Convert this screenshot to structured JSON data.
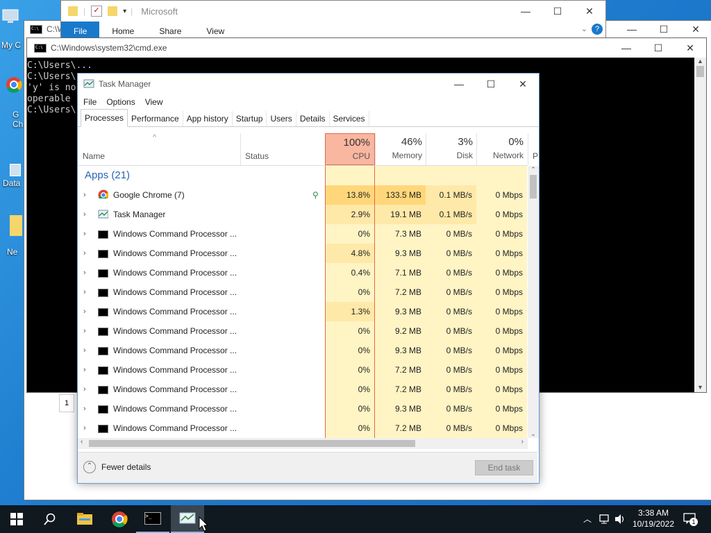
{
  "desktop": {
    "icons": [
      {
        "label": "My C"
      },
      {
        "label": "G\nCh"
      },
      {
        "label": "Data"
      },
      {
        "label": "Ne"
      }
    ]
  },
  "explorer": {
    "title": "Microsoft",
    "ribbon_tabs": [
      "File",
      "Home",
      "Share",
      "View"
    ]
  },
  "cmd_back": {
    "title": "C:\\W"
  },
  "cmd_main": {
    "title": "C:\\Windows\\system32\\cmd.exe",
    "lines": [
      "",
      "C:\\Users\\...",
      "",
      "C:\\Users\\",
      "'y' is no",
      "operable",
      "",
      "C:\\Users\\"
    ]
  },
  "task_manager": {
    "title": "Task Manager",
    "menu": [
      "File",
      "Options",
      "View"
    ],
    "tabs": [
      "Processes",
      "Performance",
      "App history",
      "Startup",
      "Users",
      "Details",
      "Services"
    ],
    "columns": {
      "name": "Name",
      "status": "Status",
      "cpu": {
        "pct": "100%",
        "label": "CPU"
      },
      "memory": {
        "pct": "46%",
        "label": "Memory"
      },
      "disk": {
        "pct": "3%",
        "label": "Disk"
      },
      "network": {
        "pct": "0%",
        "label": "Network"
      },
      "power": "P"
    },
    "group_label": "Apps (21)",
    "processes": [
      {
        "name": "Google Chrome (7)",
        "icon": "chrome-icon",
        "cpu": "13.8%",
        "memory": "133.5 MB",
        "disk": "0.1 MB/s",
        "network": "0 Mbps"
      },
      {
        "name": "Task Manager",
        "icon": "task-manager-icon",
        "cpu": "2.9%",
        "memory": "19.1 MB",
        "disk": "0.1 MB/s",
        "network": "0 Mbps"
      },
      {
        "name": "Windows Command Processor ...",
        "icon": "cmd-icon",
        "cpu": "0%",
        "memory": "7.3 MB",
        "disk": "0 MB/s",
        "network": "0 Mbps"
      },
      {
        "name": "Windows Command Processor ...",
        "icon": "cmd-icon",
        "cpu": "4.8%",
        "memory": "9.3 MB",
        "disk": "0 MB/s",
        "network": "0 Mbps"
      },
      {
        "name": "Windows Command Processor ...",
        "icon": "cmd-icon",
        "cpu": "0.4%",
        "memory": "7.1 MB",
        "disk": "0 MB/s",
        "network": "0 Mbps"
      },
      {
        "name": "Windows Command Processor ...",
        "icon": "cmd-icon",
        "cpu": "0%",
        "memory": "7.2 MB",
        "disk": "0 MB/s",
        "network": "0 Mbps"
      },
      {
        "name": "Windows Command Processor ...",
        "icon": "cmd-icon",
        "cpu": "1.3%",
        "memory": "9.3 MB",
        "disk": "0 MB/s",
        "network": "0 Mbps"
      },
      {
        "name": "Windows Command Processor ...",
        "icon": "cmd-icon",
        "cpu": "0%",
        "memory": "9.2 MB",
        "disk": "0 MB/s",
        "network": "0 Mbps"
      },
      {
        "name": "Windows Command Processor ...",
        "icon": "cmd-icon",
        "cpu": "0%",
        "memory": "9.3 MB",
        "disk": "0 MB/s",
        "network": "0 Mbps"
      },
      {
        "name": "Windows Command Processor ...",
        "icon": "cmd-icon",
        "cpu": "0%",
        "memory": "7.2 MB",
        "disk": "0 MB/s",
        "network": "0 Mbps"
      },
      {
        "name": "Windows Command Processor ...",
        "icon": "cmd-icon",
        "cpu": "0%",
        "memory": "7.2 MB",
        "disk": "0 MB/s",
        "network": "0 Mbps"
      },
      {
        "name": "Windows Command Processor ...",
        "icon": "cmd-icon",
        "cpu": "0%",
        "memory": "9.3 MB",
        "disk": "0 MB/s",
        "network": "0 Mbps"
      },
      {
        "name": "Windows Command Processor ...",
        "icon": "cmd-icon",
        "cpu": "0%",
        "memory": "7.2 MB",
        "disk": "0 MB/s",
        "network": "0 Mbps"
      }
    ],
    "footer": {
      "fewer_details": "Fewer details",
      "end_task": "End task"
    }
  },
  "taskbar": {
    "items": [
      "start-icon",
      "search-icon",
      "file-explorer-icon",
      "chrome-icon",
      "cmd-icon",
      "task-manager-icon"
    ],
    "clock_time": "3:38 AM",
    "clock_date": "10/19/2022",
    "notification_count": "1"
  },
  "colors": {
    "accent": "#1979ca",
    "cpu_header_hot": "#f9b6a0",
    "heat_light": "#fff4c4",
    "heat_mid": "#ffe9a8",
    "heat_high": "#ffd77a"
  }
}
